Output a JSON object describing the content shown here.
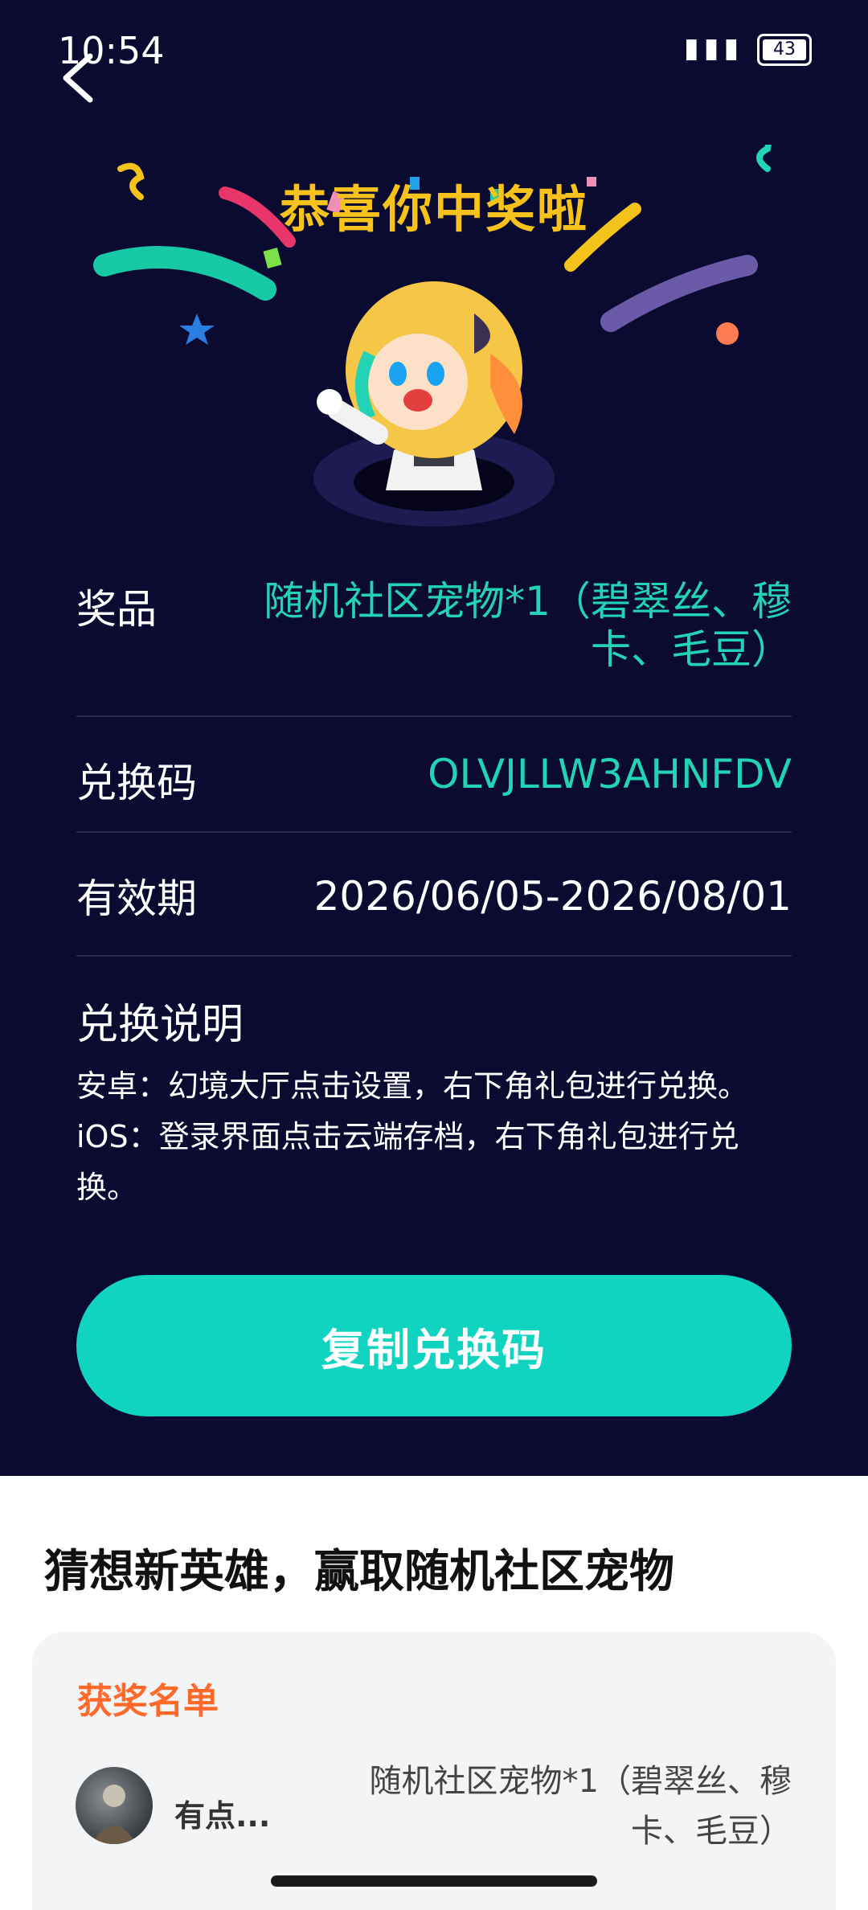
{
  "status_bar": {
    "time": "10:54",
    "battery": "43"
  },
  "header": {
    "congrats_title": "恭喜你中奖啦"
  },
  "prize_info": {
    "prize_label": "奖品",
    "prize_value_line1": "随机社区宠物*1（碧翠丝、穆",
    "prize_value_line2": "卡、毛豆）",
    "code_label": "兑换码",
    "code_value": "OLVJLLW3AHNFDV",
    "validity_label": "有效期",
    "validity_value": "2026/06/05-2026/08/01"
  },
  "instructions": {
    "title": "兑换说明",
    "line1": "安卓：幻境大厅点击设置，右下角礼包进行兑换。",
    "line2": "iOS：登录界面点击云端存档，右下角礼包进行兑",
    "line3": "换。"
  },
  "copy_button": {
    "label": "复制兑换码"
  },
  "event": {
    "title": "猜想新英雄，赢取随机社区宠物"
  },
  "winners": {
    "title": "获奖名单",
    "items": [
      {
        "name": "有点...",
        "prize_line1": "随机社区宠物*1（碧翠丝、穆",
        "prize_line2": "卡、毛豆）"
      }
    ]
  },
  "colors": {
    "accent_teal": "#10d4c0",
    "title_yellow": "#f7c21b",
    "winner_title_orange": "#ff6a2b",
    "bg_dark": "#0b0a30"
  }
}
